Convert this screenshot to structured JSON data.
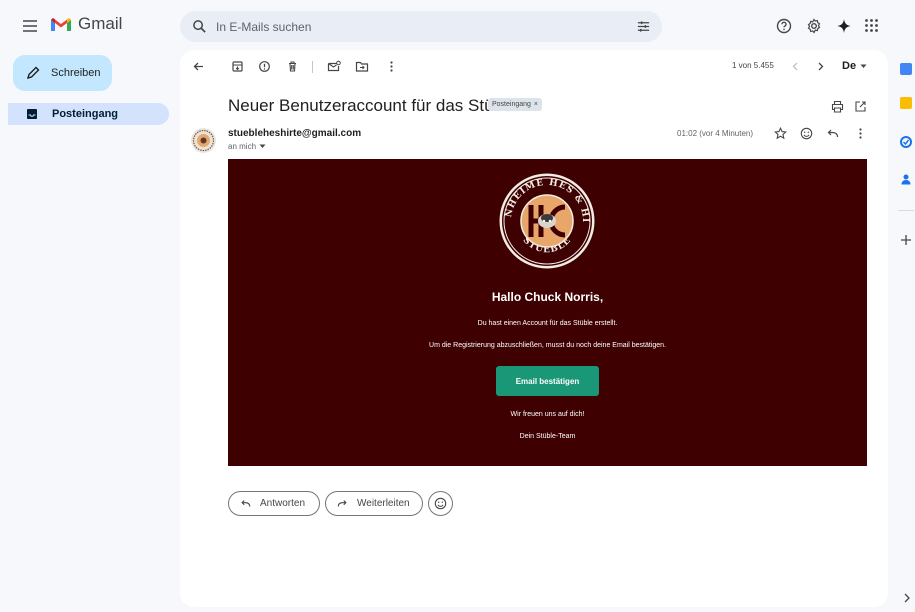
{
  "header": {
    "app_name": "Gmail",
    "search": {
      "placeholder": "In E-Mails suchen",
      "value": ""
    }
  },
  "sidebar": {
    "compose_label": "Schreiben",
    "items": [
      {
        "label": "Posteingang",
        "selected": true
      }
    ]
  },
  "toolbar": {
    "pager_text": "1 von 5.455",
    "input_language": "De"
  },
  "message": {
    "subject": "Neuer Benutzeraccount für das Stüble",
    "label": "Posteingang",
    "label_close": "×",
    "sender": "stuebleheshirte@gmail.com",
    "recipient": "an mich",
    "time": "01:02 (vor 4 Minuten)"
  },
  "email_body": {
    "greeting": "Hallo Chuck Norris,",
    "line1": "Du hast einen Account für das Stüble erstellt.",
    "line2": "Um die Registrierung abzuschließen, musst du noch deine Email bestätigen.",
    "button_label": "Email bestätigen",
    "closing1": "Wir freuen uns auf dich!",
    "closing2": "Dein Stüble-Team",
    "crest_text": "WOHNHEIME HES & HIRTE · STUEBLE"
  },
  "reply_actions": {
    "reply_label": "Antworten",
    "forward_label": "Weiterleiten"
  },
  "colors": {
    "email_background": "#3e0000",
    "button": "#1a9776",
    "compose": "#c2e7ff",
    "selected_nav": "#d3e3fd"
  }
}
